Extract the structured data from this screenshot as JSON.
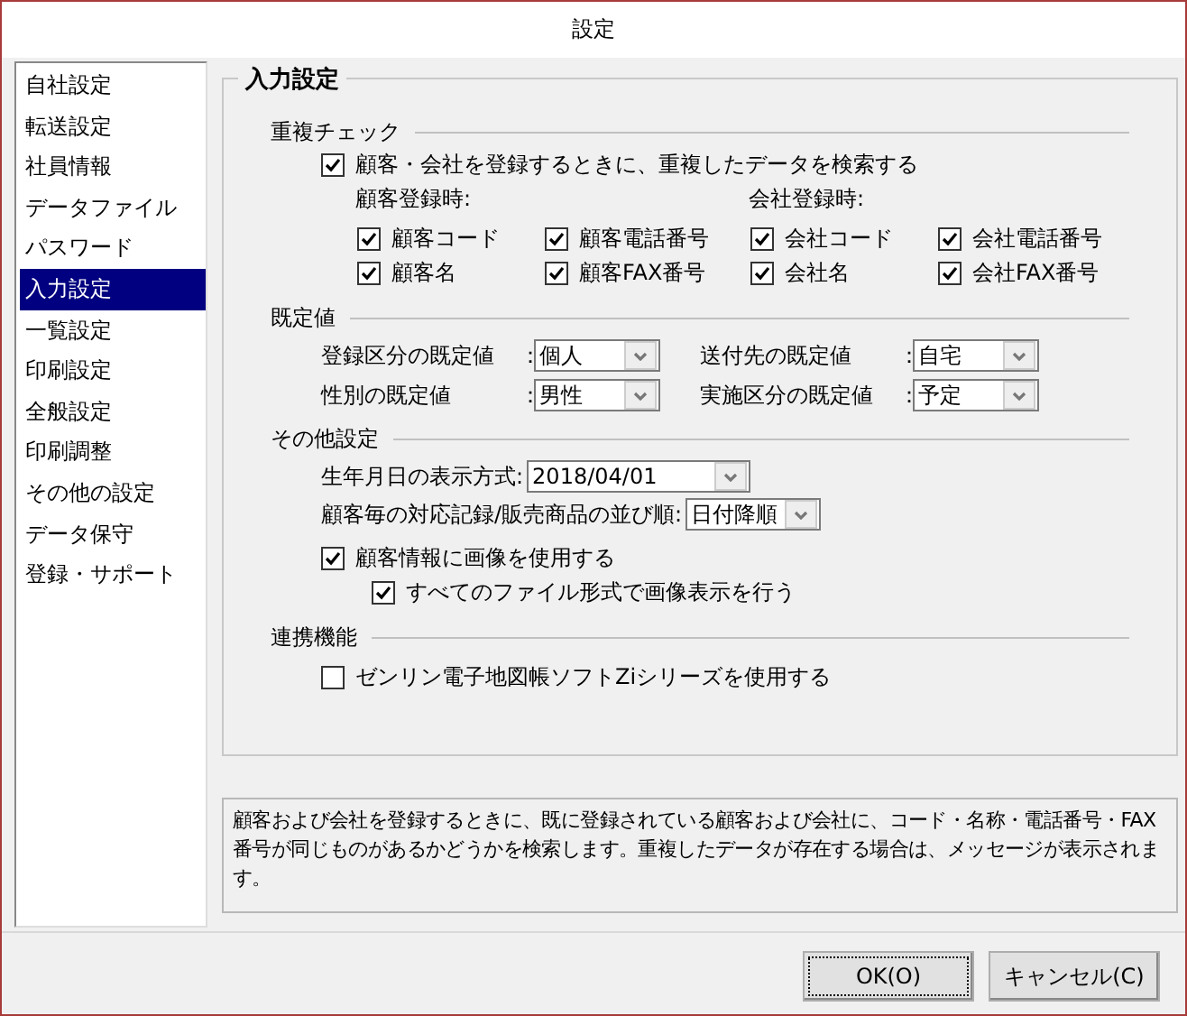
{
  "window": {
    "title": "設定"
  },
  "sidebar": {
    "items": [
      {
        "label": "自社設定",
        "selected": false
      },
      {
        "label": "転送設定",
        "selected": false
      },
      {
        "label": "社員情報",
        "selected": false
      },
      {
        "label": "データファイル",
        "selected": false
      },
      {
        "label": "パスワード",
        "selected": false
      },
      {
        "label": "入力設定",
        "selected": true
      },
      {
        "label": "一覧設定",
        "selected": false
      },
      {
        "label": "印刷設定",
        "selected": false
      },
      {
        "label": "全般設定",
        "selected": false
      },
      {
        "label": "印刷調整",
        "selected": false
      },
      {
        "label": "その他の設定",
        "selected": false
      },
      {
        "label": "データ保守",
        "selected": false
      },
      {
        "label": "登録・サポート",
        "selected": false
      }
    ]
  },
  "panel": {
    "title": "入力設定",
    "sections": [
      {
        "kind": "duplicate",
        "heading": "重複チェック",
        "main": {
          "label": "顧客・会社を登録するときに、重複したデータを検索する",
          "checked": true
        },
        "groups": [
          {
            "heading": "顧客登録時:",
            "options": [
              {
                "label": "顧客コード",
                "checked": true
              },
              {
                "label": "顧客電話番号",
                "checked": true
              },
              {
                "label": "顧客名",
                "checked": true
              },
              {
                "label": "顧客FAX番号",
                "checked": true
              }
            ]
          },
          {
            "heading": "会社登録時:",
            "options": [
              {
                "label": "会社コード",
                "checked": true
              },
              {
                "label": "会社電話番号",
                "checked": true
              },
              {
                "label": "会社名",
                "checked": true
              },
              {
                "label": "会社FAX番号",
                "checked": true
              }
            ]
          }
        ]
      },
      {
        "kind": "defaults",
        "heading": "既定値",
        "fields": [
          {
            "label": "登録区分の既定値",
            "colon": "：",
            "value": "個人"
          },
          {
            "label": "送付先の既定値",
            "colon": "：",
            "value": "自宅"
          },
          {
            "label": "性別の既定値",
            "colon": "：",
            "value": "男性"
          },
          {
            "label": "実施区分の既定値",
            "colon": "：",
            "value": "予定"
          }
        ]
      },
      {
        "kind": "other",
        "heading": "その他設定",
        "fields": [
          {
            "label": "生年月日の表示方式:",
            "value": "2018/04/01"
          },
          {
            "label": "顧客毎の対応記録/販売商品の並び順:",
            "value": "日付降順"
          }
        ],
        "options": [
          {
            "label": "顧客情報に画像を使用する",
            "checked": true,
            "children": [
              {
                "label": "すべてのファイル形式で画像表示を行う",
                "checked": true
              }
            ]
          }
        ]
      },
      {
        "kind": "link",
        "heading": "連携機能",
        "options": [
          {
            "label": "ゼンリン電子地図帳ソフトZiシリーズを使用する",
            "checked": false
          }
        ]
      }
    ]
  },
  "description": "顧客および会社を登録するときに、既に登録されている顧客および会社に、コード・名称・電話番号・FAX番号が同じものがあるかどうかを検索します。重複したデータが存在する場合は、メッセージが表示されます。",
  "buttons": [
    {
      "label": "OK(O)",
      "focused": true
    },
    {
      "label": "キャンセル(C)",
      "focused": false
    }
  ]
}
